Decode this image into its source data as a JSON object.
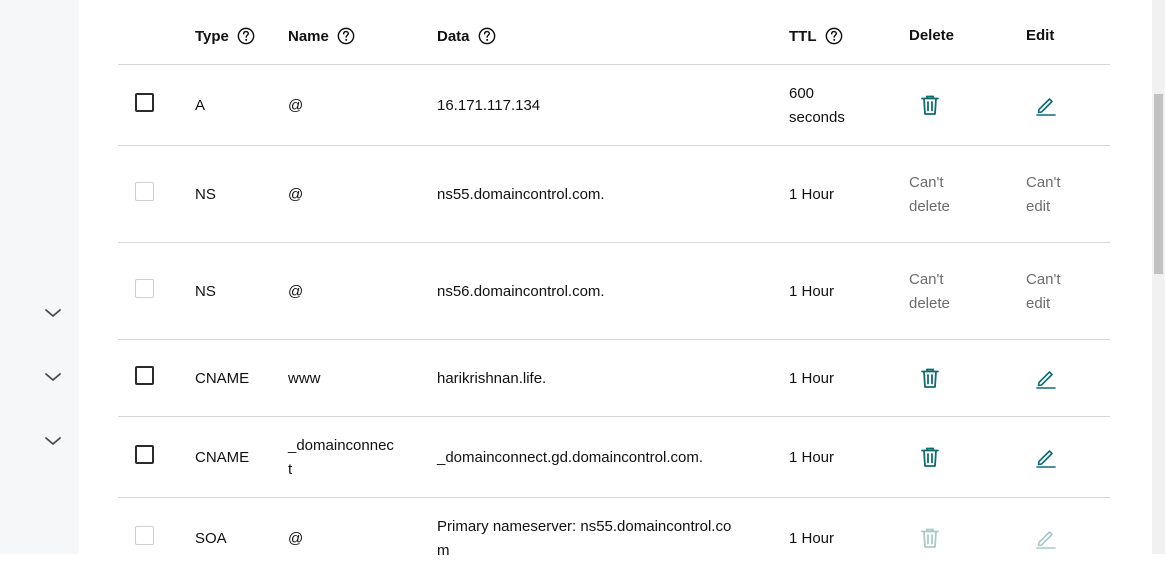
{
  "colors": {
    "accent": "#0f6b73",
    "disabled_icon": "#a9c9cb",
    "border": "#d6d6d6",
    "rail": "#f5f7f8"
  },
  "header": {
    "type": "Type",
    "name": "Name",
    "data": "Data",
    "ttl": "TTL",
    "delete": "Delete",
    "edit": "Edit",
    "help_icon": "question-circle-icon"
  },
  "sidebar": {
    "chevron_icon": "chevron-down-icon"
  },
  "records": [
    {
      "type": "A",
      "name": "@",
      "data": "16.171.117.134",
      "ttl_line1": "600",
      "ttl_line2": "seconds",
      "delete": "trash-icon",
      "edit": "pencil-icon"
    },
    {
      "type": "NS",
      "name": "@",
      "data": "ns55.domaincontrol.com.",
      "ttl": "1 Hour",
      "delete_line1": "Can't",
      "delete_line2": "delete",
      "edit_line1": "Can't",
      "edit_line2": "edit"
    },
    {
      "type": "NS",
      "name": "@",
      "data": "ns56.domaincontrol.com.",
      "ttl": "1 Hour",
      "delete_line1": "Can't",
      "delete_line2": "delete",
      "edit_line1": "Can't",
      "edit_line2": "edit"
    },
    {
      "type": "CNAME",
      "name": "www",
      "data": "harikrishnan.life.",
      "ttl": "1 Hour",
      "delete": "trash-icon",
      "edit": "pencil-icon"
    },
    {
      "type": "CNAME",
      "name_line1": "_domainconnec",
      "name_line2": "t",
      "data": "_domainconnect.gd.domaincontrol.com.",
      "ttl": "1 Hour",
      "delete": "trash-icon",
      "edit": "pencil-icon"
    },
    {
      "type": "SOA",
      "name": "@",
      "data_line1": "Primary nameserver: ns55.domaincontrol.co",
      "data_line2": "m",
      "ttl": "1 Hour",
      "delete": "trash-icon-disabled",
      "edit": "pencil-icon-disabled"
    }
  ]
}
